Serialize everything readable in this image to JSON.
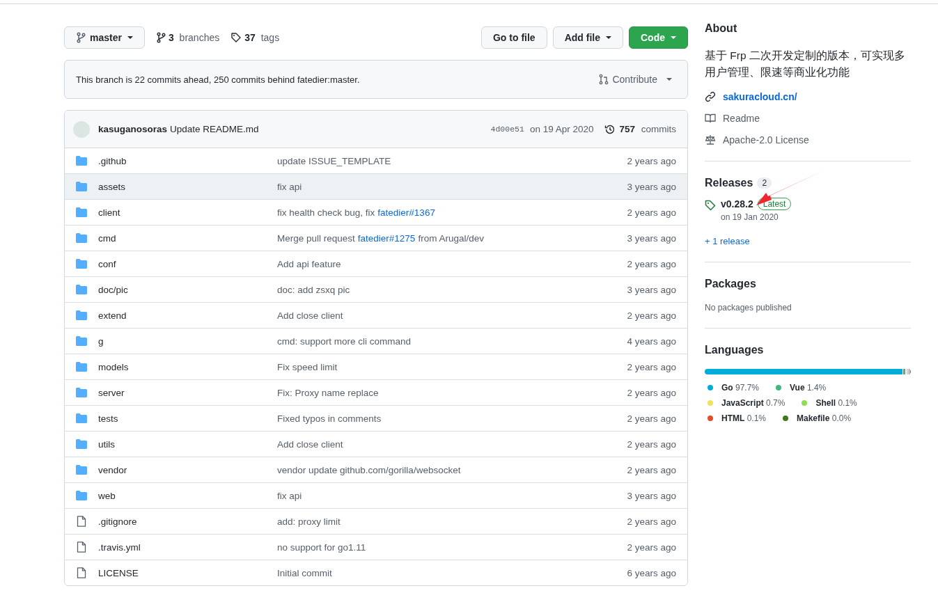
{
  "branch_bar": {
    "branch": "master",
    "branches_count": "3",
    "branches_label": "branches",
    "tags_count": "37",
    "tags_label": "tags",
    "buttons": [
      {
        "label": "Go to file",
        "kind": "plain"
      },
      {
        "label": "Add file",
        "kind": "dropdown"
      },
      {
        "label": "Code",
        "kind": "primary"
      }
    ]
  },
  "branch_status": {
    "text": "This branch is 22 commits ahead, 250 commits behind fatedier:master.",
    "contribute": "Contribute"
  },
  "latest_commit": {
    "author": "kasuganosoras",
    "message": "Update README.md",
    "sha": "4d00e51",
    "date": "on 19 Apr 2020",
    "commits_count": "757",
    "commits_label": "commits"
  },
  "files": [
    {
      "name": ".github",
      "kind": "folder",
      "hovered": false,
      "message": [
        {
          "text": "update ISSUE_TEMPLATE",
          "link": false
        }
      ],
      "age": "2 years ago"
    },
    {
      "name": "assets",
      "kind": "folder",
      "hovered": true,
      "message": [
        {
          "text": "fix api",
          "link": false
        }
      ],
      "age": "3 years ago"
    },
    {
      "name": "client",
      "kind": "folder",
      "hovered": false,
      "message": [
        {
          "text": "fix health check bug, fix",
          "link": false
        },
        {
          "text": "fatedier#1367",
          "link": true
        }
      ],
      "age": "2 years ago"
    },
    {
      "name": "cmd",
      "kind": "folder",
      "hovered": false,
      "message": [
        {
          "text": "Merge pull request",
          "link": false
        },
        {
          "text": "fatedier#1275",
          "link": true
        },
        {
          "text": "from Arugal/dev",
          "link": false
        }
      ],
      "age": "3 years ago"
    },
    {
      "name": "conf",
      "kind": "folder",
      "hovered": false,
      "message": [
        {
          "text": "Add api feature",
          "link": false
        }
      ],
      "age": "2 years ago"
    },
    {
      "name": "doc/pic",
      "kind": "folder",
      "hovered": false,
      "message": [
        {
          "text": "doc: add zsxq pic",
          "link": false
        }
      ],
      "age": "3 years ago"
    },
    {
      "name": "extend",
      "kind": "folder",
      "hovered": false,
      "message": [
        {
          "text": "Add close client",
          "link": false
        }
      ],
      "age": "2 years ago"
    },
    {
      "name": "g",
      "kind": "folder",
      "hovered": false,
      "message": [
        {
          "text": "cmd: support more cli command",
          "link": false
        }
      ],
      "age": "4 years ago"
    },
    {
      "name": "models",
      "kind": "folder",
      "hovered": false,
      "message": [
        {
          "text": "Fix speed limit",
          "link": false
        }
      ],
      "age": "2 years ago"
    },
    {
      "name": "server",
      "kind": "folder",
      "hovered": false,
      "message": [
        {
          "text": "Fix: Proxy name replace",
          "link": false
        }
      ],
      "age": "2 years ago"
    },
    {
      "name": "tests",
      "kind": "folder",
      "hovered": false,
      "message": [
        {
          "text": "Fixed typos in comments",
          "link": false
        }
      ],
      "age": "2 years ago"
    },
    {
      "name": "utils",
      "kind": "folder",
      "hovered": false,
      "message": [
        {
          "text": "Add close client",
          "link": false
        }
      ],
      "age": "2 years ago"
    },
    {
      "name": "vendor",
      "kind": "folder",
      "hovered": false,
      "message": [
        {
          "text": "vendor update github.com/gorilla/websocket",
          "link": false
        }
      ],
      "age": "2 years ago"
    },
    {
      "name": "web",
      "kind": "folder",
      "hovered": false,
      "message": [
        {
          "text": "fix api",
          "link": false
        }
      ],
      "age": "3 years ago"
    },
    {
      "name": ".gitignore",
      "kind": "file",
      "hovered": false,
      "message": [
        {
          "text": "add: proxy limit",
          "link": false
        }
      ],
      "age": "2 years ago"
    },
    {
      "name": ".travis.yml",
      "kind": "file",
      "hovered": false,
      "message": [
        {
          "text": "no support for go1.11",
          "link": false
        }
      ],
      "age": "2 years ago"
    },
    {
      "name": "LICENSE",
      "kind": "file",
      "hovered": false,
      "message": [
        {
          "text": "Initial commit",
          "link": false
        }
      ],
      "age": "6 years ago"
    }
  ],
  "about": {
    "title": "About",
    "description": "基于 Frp 二次开发定制的版本，可实现多用户管理、限速等商业化功能",
    "website": "sakuracloud.cn/",
    "readme": "Readme",
    "license": "Apache-2.0 License"
  },
  "releases": {
    "title": "Releases",
    "count": "2",
    "latest": {
      "version": "v0.28.2",
      "badge": "Latest",
      "date": "on 19 Jan 2020"
    },
    "more": "+ 1 release"
  },
  "packages": {
    "title": "Packages",
    "empty": "No packages published"
  },
  "languages": {
    "title": "Languages",
    "items": [
      {
        "name": "Go",
        "percent": "97.7%",
        "level": 0.977,
        "color": "#00add8"
      },
      {
        "name": "Vue",
        "percent": "1.4%",
        "level": 0.014,
        "color": "#41b883"
      },
      {
        "name": "JavaScript",
        "percent": "0.7%",
        "level": 0.007,
        "color": "#f1e05a"
      },
      {
        "name": "Shell",
        "percent": "0.1%",
        "level": 0.001,
        "color": "#89e051"
      },
      {
        "name": "HTML",
        "percent": "0.1%",
        "level": 0.001,
        "color": "#e34c26"
      },
      {
        "name": "Makefile",
        "percent": "0.0%",
        "level": 0.0005,
        "color": "#427819"
      }
    ]
  }
}
